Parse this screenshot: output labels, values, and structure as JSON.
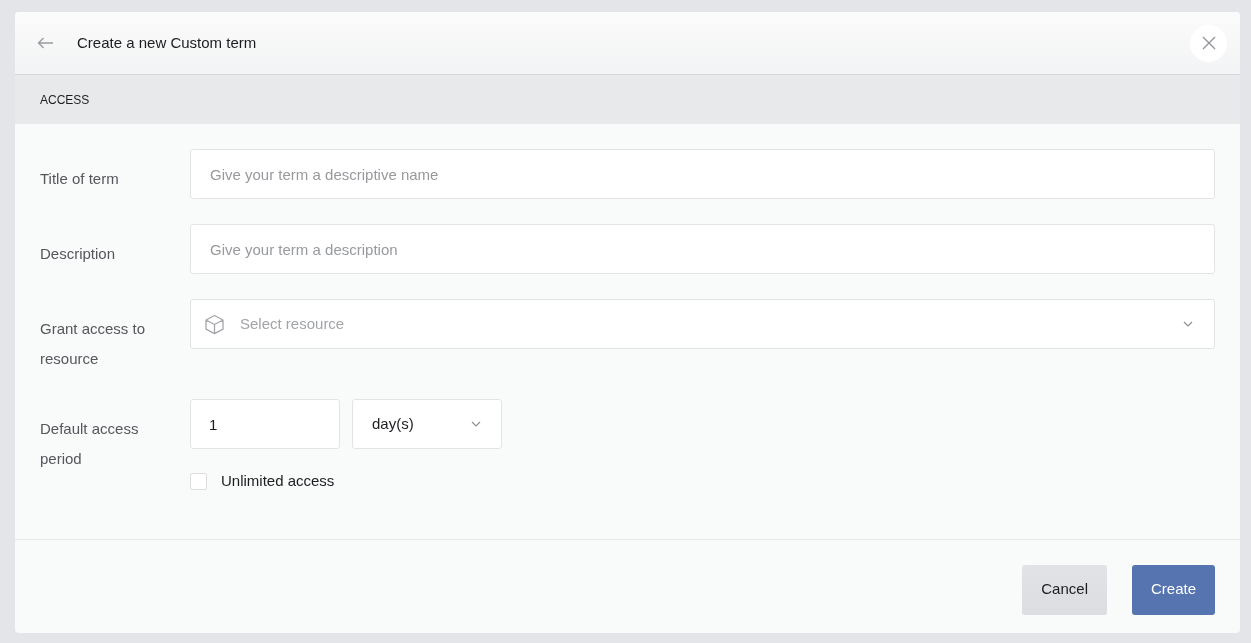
{
  "dialog": {
    "title": "Create a new Custom term"
  },
  "section": {
    "title": "ACCESS"
  },
  "fields": [
    {
      "kind": "text",
      "label": "Title of term",
      "placeholder": "Give your term a descriptive name"
    },
    {
      "kind": "text",
      "label": "Description",
      "placeholder": "Give your term a description"
    },
    {
      "kind": "select",
      "label": "Grant access to resource",
      "placeholder": "Select resource"
    },
    {
      "kind": "period",
      "label": "Default access period",
      "value": "1",
      "unit": "day(s)",
      "checkbox": {
        "label": "Unlimited access",
        "checked": false
      }
    }
  ],
  "buttons": [
    {
      "label": "Cancel",
      "kind": "secondary"
    },
    {
      "label": "Create",
      "kind": "primary"
    }
  ]
}
